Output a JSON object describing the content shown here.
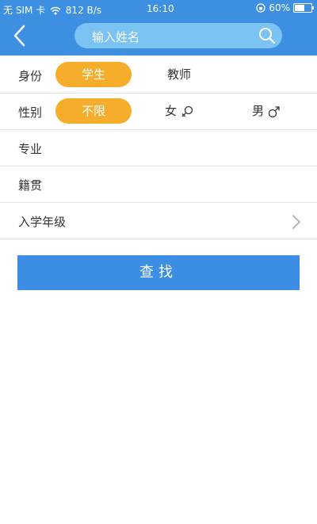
{
  "status_bar": {
    "carrier": "无 SIM 卡",
    "speed": "812 B/s",
    "time": "16:10",
    "battery": "60%",
    "battery_level": 0.6
  },
  "header": {
    "search_placeholder": "输入姓名"
  },
  "form": {
    "identity": {
      "label": "身份",
      "options": [
        "学生",
        "教师"
      ],
      "selected": "学生"
    },
    "gender": {
      "label": "性别",
      "options": [
        "不限",
        "女",
        "男"
      ],
      "selected": "不限"
    },
    "major": {
      "label": "专业"
    },
    "hometown": {
      "label": "籍贯"
    },
    "enroll_year": {
      "label": "入学年级"
    }
  },
  "actions": {
    "search_label": "查找"
  },
  "colors": {
    "header": "#3d8fe2",
    "search_bg": "#7bc3f3",
    "accent": "#f5ad2b",
    "button": "#3b8ee4"
  },
  "icons": {
    "back": "chevron-left-icon",
    "search": "search-icon",
    "female": "female-icon",
    "male": "male-icon",
    "next": "chevron-right-icon"
  }
}
